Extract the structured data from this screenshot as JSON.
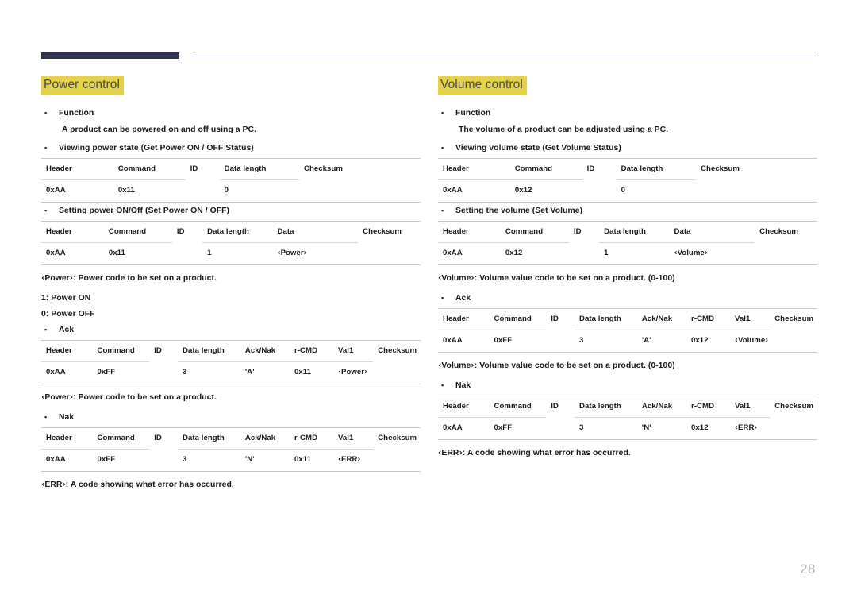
{
  "page": {
    "number": "28"
  },
  "columns": [
    {
      "id": "power-control",
      "title": "Power control",
      "blocks": [
        {
          "kind": "bullet",
          "label": "Function"
        },
        {
          "kind": "subline",
          "text": "A product can be powered on and off using a PC."
        },
        {
          "kind": "bullet",
          "label": "Viewing power state (Get Power ON / OFF Status)"
        },
        {
          "kind": "table",
          "layout": "w5",
          "headers": [
            "Header",
            "Command",
            "ID",
            "Data length",
            "Checksum"
          ],
          "rows": [
            [
              "0xAA",
              "0x11",
              "",
              "0",
              ""
            ]
          ]
        },
        {
          "kind": "bullet",
          "label": "Setting power ON/Off (Set Power ON / OFF)"
        },
        {
          "kind": "table",
          "layout": "w6",
          "headers": [
            "Header",
            "Command",
            "ID",
            "Data length",
            "Data",
            "Checksum"
          ],
          "rows": [
            [
              "0xAA",
              "0x11",
              "",
              "1",
              "‹Power›",
              ""
            ]
          ]
        },
        {
          "kind": "note",
          "text": "‹Power›: Power code to be set on a product."
        },
        {
          "kind": "note-tight",
          "text": "1: Power ON"
        },
        {
          "kind": "note-tight",
          "text": "0: Power OFF"
        },
        {
          "kind": "bullet",
          "label": "Ack"
        },
        {
          "kind": "table",
          "layout": "w8",
          "headers": [
            "Header",
            "Command",
            "ID",
            "Data length",
            "Ack/Nak",
            "r-CMD",
            "Val1",
            "Checksum"
          ],
          "rows": [
            [
              "0xAA",
              "0xFF",
              "",
              "3",
              "'A'",
              "0x11",
              "‹Power›",
              ""
            ]
          ]
        },
        {
          "kind": "note",
          "text": "‹Power›: Power code to be set on a product."
        },
        {
          "kind": "bullet",
          "label": "Nak"
        },
        {
          "kind": "table",
          "layout": "w8",
          "headers": [
            "Header",
            "Command",
            "ID",
            "Data length",
            "Ack/Nak",
            "r-CMD",
            "Val1",
            "Checksum"
          ],
          "rows": [
            [
              "0xAA",
              "0xFF",
              "",
              "3",
              "'N'",
              "0x11",
              "‹ERR›",
              ""
            ]
          ]
        },
        {
          "kind": "note",
          "text": "‹ERR›: A code showing what error has occurred."
        }
      ]
    },
    {
      "id": "volume-control",
      "title": "Volume control",
      "blocks": [
        {
          "kind": "bullet",
          "label": "Function"
        },
        {
          "kind": "subline",
          "text": "The volume of a product can be adjusted using a PC."
        },
        {
          "kind": "bullet",
          "label": "Viewing volume state (Get Volume Status)"
        },
        {
          "kind": "table",
          "layout": "w5",
          "headers": [
            "Header",
            "Command",
            "ID",
            "Data length",
            "Checksum"
          ],
          "rows": [
            [
              "0xAA",
              "0x12",
              "",
              "0",
              ""
            ]
          ]
        },
        {
          "kind": "bullet",
          "label": "Setting the volume (Set Volume)"
        },
        {
          "kind": "table",
          "layout": "w6",
          "headers": [
            "Header",
            "Command",
            "ID",
            "Data length",
            "Data",
            "Checksum"
          ],
          "rows": [
            [
              "0xAA",
              "0x12",
              "",
              "1",
              "‹Volume›",
              ""
            ]
          ]
        },
        {
          "kind": "note",
          "text": "‹Volume›: Volume value code to be set on a product. (0-100)"
        },
        {
          "kind": "bullet",
          "label": "Ack"
        },
        {
          "kind": "table",
          "layout": "w8",
          "headers": [
            "Header",
            "Command",
            "ID",
            "Data length",
            "Ack/Nak",
            "r-CMD",
            "Val1",
            "Checksum"
          ],
          "rows": [
            [
              "0xAA",
              "0xFF",
              "",
              "3",
              "'A'",
              "0x12",
              "‹Volume›",
              ""
            ]
          ]
        },
        {
          "kind": "note",
          "text": "‹Volume›: Volume value code to be set on a product. (0-100)"
        },
        {
          "kind": "bullet",
          "label": "Nak"
        },
        {
          "kind": "table",
          "layout": "w8",
          "headers": [
            "Header",
            "Command",
            "ID",
            "Data length",
            "Ack/Nak",
            "r-CMD",
            "Val1",
            "Checksum"
          ],
          "rows": [
            [
              "0xAA",
              "0xFF",
              "",
              "3",
              "'N'",
              "0x12",
              "‹ERR›",
              ""
            ]
          ]
        },
        {
          "kind": "note",
          "text": "‹ERR›: A code showing what error has occurred."
        }
      ]
    }
  ],
  "colors": {
    "rule_dark": "#2e3450",
    "highlight": "#e6d24a",
    "text": "#1a1a1a",
    "page_number": "#b8b8b8"
  }
}
